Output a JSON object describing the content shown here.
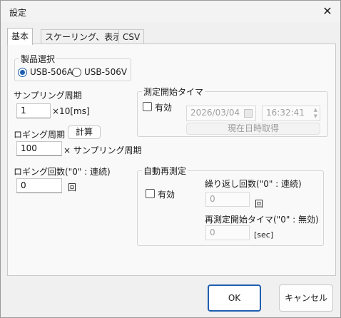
{
  "window": {
    "title": "設定",
    "close_glyph": "✕"
  },
  "tabs": [
    {
      "label": "基本",
      "active": true
    },
    {
      "label": "スケーリング、表示",
      "active": false
    },
    {
      "label": "CSV",
      "active": false
    }
  ],
  "product": {
    "group_label": "製品選択",
    "options": [
      {
        "label": "USB-506A",
        "checked": true
      },
      {
        "label": "USB-506V",
        "checked": false
      }
    ]
  },
  "sampling": {
    "label": "サンプリング周期",
    "value": "1",
    "unit": "×10[ms]"
  },
  "logging_period": {
    "label": "ロギング周期",
    "calc_button": "計算",
    "value": "100",
    "unit": "× サンプリング周期"
  },
  "logging_count": {
    "label": "ロギング回数(\"0\" : 連続)",
    "value": "0",
    "unit": "回"
  },
  "measure_start": {
    "group_label": "測定開始タイマ",
    "enable_label": "有効",
    "date": "2026/03/04",
    "time": "16:32:41",
    "now_button": "現在日時取得"
  },
  "auto_remeasure": {
    "group_label": "自動再測定",
    "enable_label": "有効",
    "repeat_label": "繰り返し回数(\"0\" : 連続)",
    "repeat_value": "0",
    "repeat_unit": "回",
    "timer_label": "再測定開始タイマ(\"0\" : 無効)",
    "timer_value": "0",
    "timer_unit": "[sec]"
  },
  "footer": {
    "ok": "OK",
    "cancel": "キャンセル"
  },
  "colors": {
    "accent": "#1f5fb0"
  }
}
